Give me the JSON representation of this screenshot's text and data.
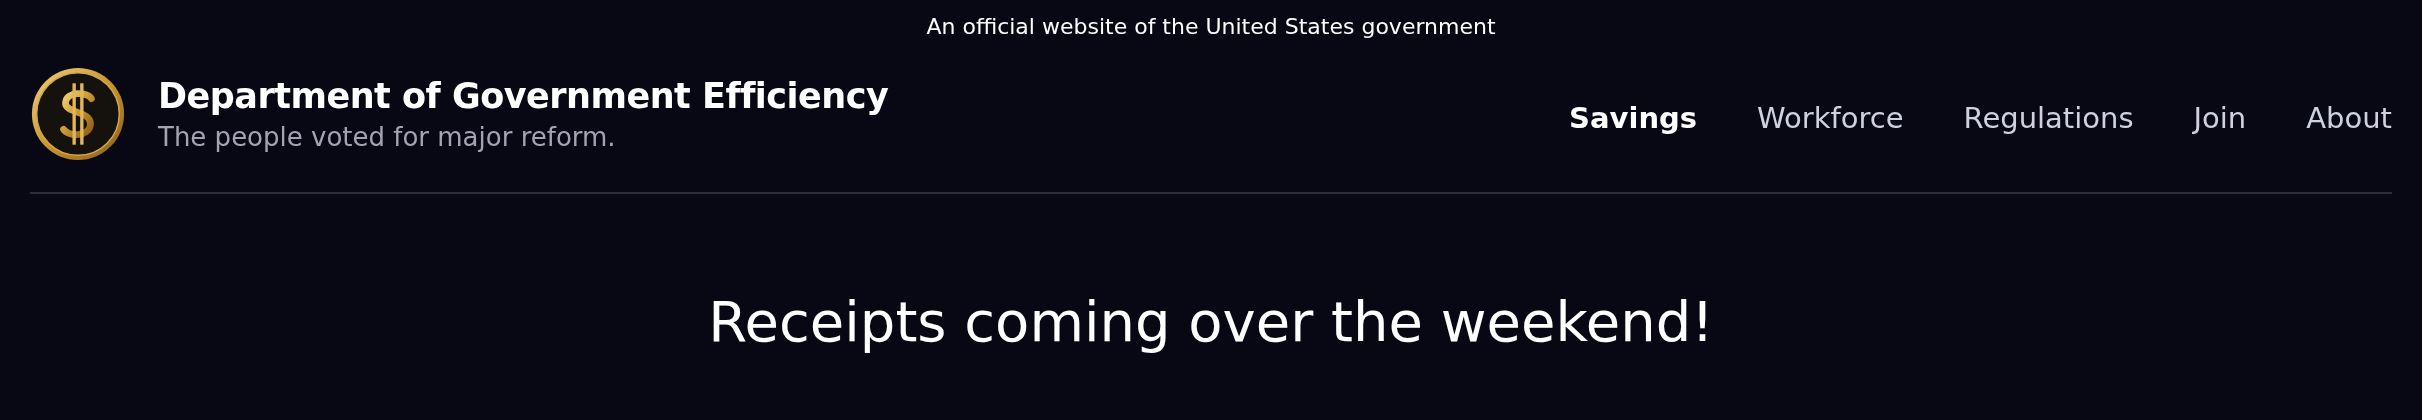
{
  "banner": {
    "text": "An official website of the United States government"
  },
  "header": {
    "title": "Department of Government Efficiency",
    "tagline": "The people voted for major reform."
  },
  "nav": [
    {
      "label": "Savings",
      "selected": true
    },
    {
      "label": "Workforce",
      "selected": false
    },
    {
      "label": "Regulations",
      "selected": false
    },
    {
      "label": "Join",
      "selected": false
    },
    {
      "label": "About",
      "selected": false
    }
  ],
  "hero": {
    "heading": "Receipts coming over the weekend!"
  }
}
